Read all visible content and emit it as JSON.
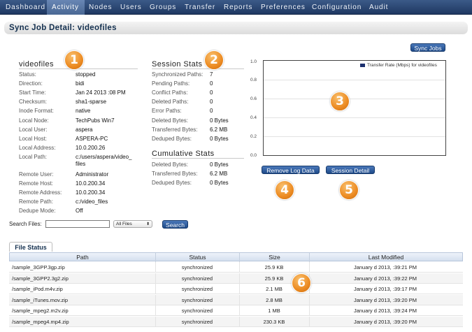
{
  "nav": {
    "items": [
      "Dashboard",
      "Activity",
      "Nodes",
      "Users",
      "Groups",
      "Transfer",
      "Reports",
      "Preferences",
      "Configuration",
      "Audit"
    ],
    "active": "Activity"
  },
  "page": {
    "title": "Sync Job Detail: videofiles"
  },
  "buttons": {
    "sync_jobs": "Sync Jobs",
    "remove_log_data": "Remove Log Data",
    "session_detail": "Session Detail",
    "search": "Search"
  },
  "badges": [
    "1",
    "2",
    "3",
    "4",
    "5",
    "6"
  ],
  "job": {
    "header": "videofiles",
    "fields": [
      {
        "label": "Status:",
        "value": "stopped"
      },
      {
        "label": "Direction:",
        "value": "bidi"
      },
      {
        "label": "Start Time:",
        "value": "Jan 24 2013 :08 PM"
      },
      {
        "label": "Checksum:",
        "value": "sha1-sparse"
      },
      {
        "label": "Inode Format:",
        "value": "native"
      },
      {
        "label": "Local Node:",
        "value": "TechPubs Win7"
      },
      {
        "label": "Local User:",
        "value": "aspera"
      },
      {
        "label": "Local Host:",
        "value": "ASPERA-PC"
      },
      {
        "label": "Local Address:",
        "value": "10.0.200.26"
      },
      {
        "label": "Local Path:",
        "value": "c:/users/aspera/video_",
        "value2": "files"
      },
      {
        "label": "Remote User:",
        "value": "Administrator"
      },
      {
        "label": "Remote Host:",
        "value": "10.0.200.34"
      },
      {
        "label": "Remote Address:",
        "value": "10.0.200.34"
      },
      {
        "label": "Remote Path:",
        "value": "c:/video_files"
      },
      {
        "label": "Dedupe Mode:",
        "value": "Off"
      }
    ]
  },
  "session_stats": {
    "header": "Session Stats",
    "fields": [
      {
        "label": "Synchronized Paths:",
        "value": "7"
      },
      {
        "label": "Pending Paths:",
        "value": "0"
      },
      {
        "label": "Conflict Paths:",
        "value": "0"
      },
      {
        "label": "Deleted Paths:",
        "value": "0"
      },
      {
        "label": "Error Paths:",
        "value": "0"
      },
      {
        "label": "Deleted Bytes:",
        "value": "0 Bytes"
      },
      {
        "label": "Transferred Bytes:",
        "value": "6.2 MB"
      },
      {
        "label": "Deduped Bytes:",
        "value": "0 Bytes"
      }
    ]
  },
  "cumulative_stats": {
    "header": "Cumulative Stats",
    "fields": [
      {
        "label": "Deleted Bytes:",
        "value": "0 Bytes"
      },
      {
        "label": "Transferred Bytes:",
        "value": "6.2 MB"
      },
      {
        "label": "Deduped Bytes:",
        "value": "0 Bytes"
      }
    ]
  },
  "chart": {
    "legend": "Transfer Rate (Mbps) for videofiles",
    "yticks": [
      "1.0",
      "0.8",
      "0.6",
      "0.4",
      "0.2",
      "0.0"
    ],
    "series_color": "#1b2f6e"
  },
  "search": {
    "label": "Search Files:",
    "value": "",
    "filter": "All Files"
  },
  "file_status": {
    "tab": "File Status",
    "columns": [
      "Path",
      "Status",
      "Size",
      "Last Modified"
    ],
    "rows": [
      {
        "path": "/sample_3GPP.3gp.zip",
        "status": "synchronized",
        "size": "25.9 KB",
        "modified": "January d 2013, :39:21 PM"
      },
      {
        "path": "/sample_3GPP2.3g2.zip",
        "status": "synchronized",
        "size": "25.9 KB",
        "modified": "January d 2013, :39:22 PM"
      },
      {
        "path": "/sample_iPod.m4v.zip",
        "status": "synchronized",
        "size": "2.1 MB",
        "modified": "January d 2013, :39:17 PM"
      },
      {
        "path": "/sample_iTunes.mov.zip",
        "status": "synchronized",
        "size": "2.8 MB",
        "modified": "January d 2013, :39:20 PM"
      },
      {
        "path": "/sample_mpeg2.m2v.zip",
        "status": "synchronized",
        "size": "1 MB",
        "modified": "January d 2013, :39:24 PM"
      },
      {
        "path": "/sample_mpeg4.mp4.zip",
        "status": "synchronized",
        "size": "230.3 KB",
        "modified": "January d 2013, :39:20 PM"
      }
    ]
  }
}
